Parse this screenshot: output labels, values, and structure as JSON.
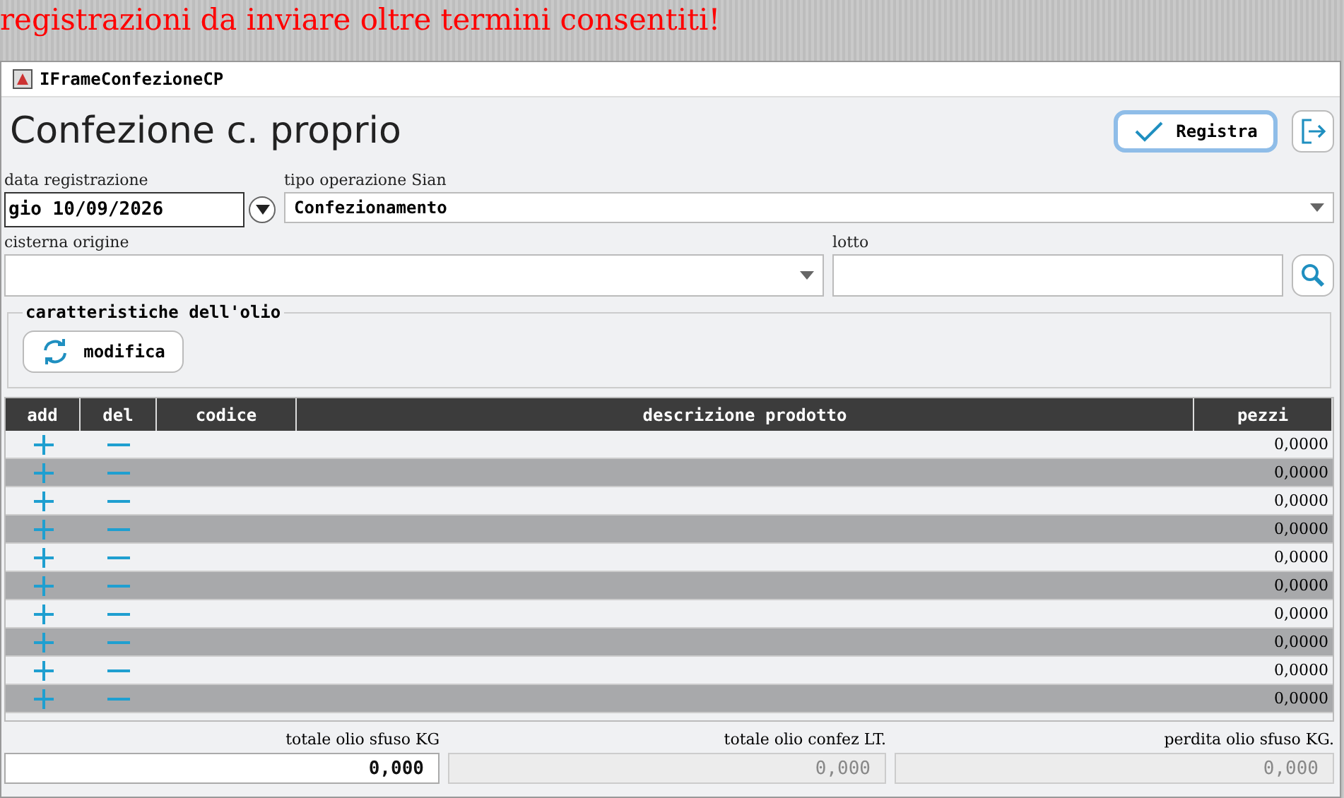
{
  "banner": "registrazioni da inviare oltre termini consentiti!",
  "window": {
    "title": "IFrameConfezioneCP"
  },
  "heading": "Confezione c. proprio",
  "buttons": {
    "save": "Registra"
  },
  "fields": {
    "date": {
      "label": "data registrazione",
      "value": "gio 10/09/2026"
    },
    "operation": {
      "label": "tipo operazione Sian",
      "value": "Confezionamento"
    },
    "tank": {
      "label": "cisterna origine"
    },
    "lot": {
      "label": "lotto"
    }
  },
  "oil": {
    "title": "caratteristiche dell'olio",
    "button": "modifica"
  },
  "table": {
    "columns": [
      "add",
      "del",
      "codice",
      "descrizione prodotto",
      "pezzi"
    ],
    "rows": [
      {
        "pezzi": "0,0000"
      },
      {
        "pezzi": "0,0000"
      },
      {
        "pezzi": "0,0000"
      },
      {
        "pezzi": "0,0000"
      },
      {
        "pezzi": "0,0000"
      },
      {
        "pezzi": "0,0000"
      },
      {
        "pezzi": "0,0000"
      },
      {
        "pezzi": "0,0000"
      },
      {
        "pezzi": "0,0000"
      },
      {
        "pezzi": "0,0000"
      }
    ]
  },
  "totals": [
    {
      "label": "totale olio sfuso KG",
      "value": "0,000",
      "disabled": false
    },
    {
      "label": "totale olio confez LT.",
      "value": "0,000",
      "disabled": true
    },
    {
      "label": "perdita olio sfuso KG.",
      "value": "0,000",
      "disabled": true
    }
  ]
}
